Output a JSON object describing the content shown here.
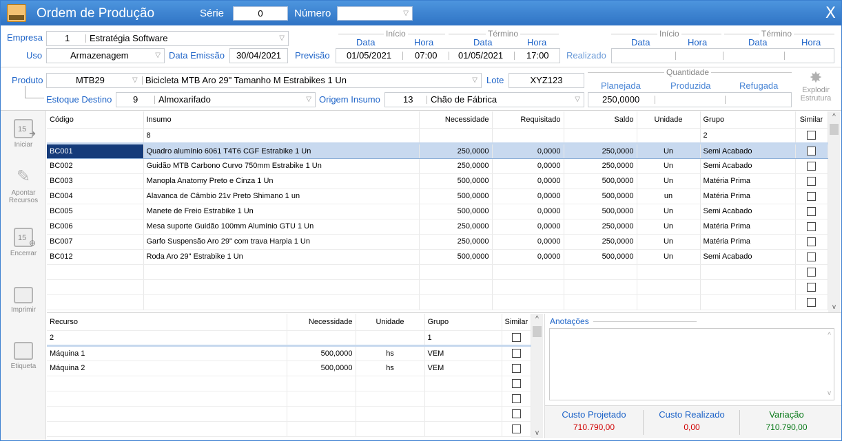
{
  "title": {
    "app": "Ordem de Produção",
    "serie_label": "Série",
    "serie_value": "0",
    "numero_label": "Número",
    "numero_value": "",
    "close": "X"
  },
  "header": {
    "empresa_label": "Empresa",
    "empresa_code": "1",
    "empresa_name": "Estratégia Software",
    "uso_label": "Uso",
    "uso_value": "Armazenagem",
    "data_emissao_label": "Data Emissão",
    "data_emissao": "30/04/2021",
    "previsao_label": "Previsão",
    "inicio_label": "Início",
    "termino_label": "Término",
    "data_label": "Data",
    "hora_label": "Hora",
    "prev_inicio_data": "01/05/2021",
    "prev_inicio_hora": "07:00",
    "prev_termino_data": "01/05/2021",
    "prev_termino_hora": "17:00",
    "realizado_label": "Realizado"
  },
  "produto": {
    "produto_label": "Produto",
    "produto_code": "MTB29",
    "produto_desc": "Bicicleta MTB Aro 29\" Tamanho M Estrabikes 1 Un",
    "lote_label": "Lote",
    "lote_value": "XYZ123",
    "estoque_label": "Estoque Destino",
    "estoque_code": "9",
    "estoque_name": "Almoxarifado",
    "origem_label": "Origem Insumo",
    "origem_code": "13",
    "origem_name": "Chão de Fábrica",
    "quantidade_label": "Quantidade",
    "planejada_label": "Planejada",
    "produzida_label": "Produzida",
    "refugada_label": "Refugada",
    "planejada_value": "250,0000",
    "explodir_label": "Explodir",
    "explodir_label2": "Estrutura"
  },
  "sidebar": {
    "iniciar": "Iniciar",
    "apontar1": "Apontar",
    "apontar2": "Recursos",
    "encerrar": "Encerrar",
    "imprimir": "Imprimir",
    "etiqueta": "Etiqueta",
    "cal_num": "15"
  },
  "insumos": {
    "columns": [
      "Código",
      "Insumo",
      "Necessidade",
      "Requisitado",
      "Saldo",
      "Unidade",
      "Grupo",
      "Similar"
    ],
    "filter": {
      "insumo": "8",
      "grupo": "2"
    },
    "rows": [
      [
        "BC001",
        "Quadro alumínio 6061 T4T6 CGF Estrabike 1 Un",
        "250,0000",
        "0,0000",
        "250,0000",
        "Un",
        "Semi Acabado"
      ],
      [
        "BC002",
        "Guidão MTB Carbono Curvo 750mm Estrabike 1 Un",
        "250,0000",
        "0,0000",
        "250,0000",
        "Un",
        "Semi Acabado"
      ],
      [
        "BC003",
        "Manopla Anatomy Preto e Cinza 1 Un",
        "500,0000",
        "0,0000",
        "500,0000",
        "Un",
        "Matéria Prima"
      ],
      [
        "BC004",
        "Alavanca de Câmbio 21v Preto Shimano 1 un",
        "500,0000",
        "0,0000",
        "500,0000",
        "un",
        "Matéria Prima"
      ],
      [
        "BC005",
        "Manete de Freio Estrabike 1 Un",
        "500,0000",
        "0,0000",
        "500,0000",
        "Un",
        "Semi Acabado"
      ],
      [
        "BC006",
        "Mesa suporte Guidão 100mm Alumínio GTU 1 Un",
        "250,0000",
        "0,0000",
        "250,0000",
        "Un",
        "Matéria Prima"
      ],
      [
        "BC007",
        "Garfo Suspensão Aro 29\" com trava Harpia 1 Un",
        "250,0000",
        "0,0000",
        "250,0000",
        "Un",
        "Matéria Prima"
      ],
      [
        "BC012",
        "Roda Aro 29\" Estrabike 1 Un",
        "500,0000",
        "0,0000",
        "500,0000",
        "Un",
        "Semi Acabado"
      ]
    ]
  },
  "recursos": {
    "columns": [
      "Recurso",
      "Necessidade",
      "Unidade",
      "Grupo",
      "Similar"
    ],
    "filter": {
      "recurso": "2",
      "grupo": "1"
    },
    "rows": [
      [
        "Máquina 1",
        "500,0000",
        "hs",
        "VEM"
      ],
      [
        "Máquina 2",
        "500,0000",
        "hs",
        "VEM"
      ]
    ]
  },
  "anotacoes": {
    "label": "Anotações"
  },
  "custos": {
    "projetado_label": "Custo Projetado",
    "projetado": "710.790,00",
    "realizado_label": "Custo Realizado",
    "realizado": "0,00",
    "variacao_label": "Variação",
    "variacao": "710.790,00",
    "red": "#d00000",
    "green": "#0a7a1a"
  }
}
